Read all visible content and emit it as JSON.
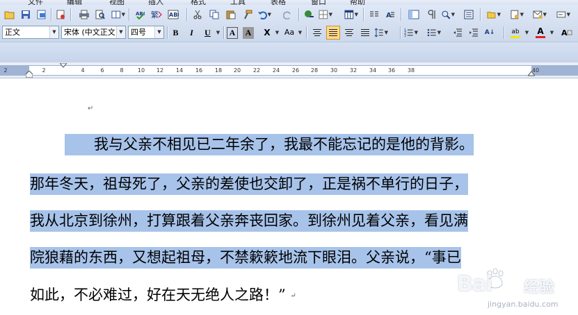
{
  "menu": {
    "items": [
      "文件",
      "编辑",
      "视图",
      "插入",
      "格式",
      "工具",
      "表格",
      "窗口",
      "帮助"
    ]
  },
  "toolbar": {
    "style_value": "正文",
    "font_value": "宋体 (中文正文",
    "size_value": "四号",
    "bold_label": "B",
    "italic_label": "I",
    "underline_label": "U",
    "border_label": "A",
    "shading_label": "A",
    "scale_label": "X",
    "case_label": "Aa",
    "highlight_label": "ab",
    "font_color_label": "A",
    "sort_label": "A↓",
    "accent_highlight": "#ffd98a",
    "font_color_swatch": "#e02020",
    "highlight_swatch": "#f3e600"
  },
  "ruler": {
    "labels": [
      "2",
      "2",
      "4",
      "6",
      "8",
      "10",
      "12",
      "14",
      "16",
      "18",
      "20",
      "22",
      "24",
      "26",
      "28",
      "30",
      "32",
      "34",
      "36",
      "38",
      "40"
    ]
  },
  "document": {
    "paragraph_mark": "↵",
    "lines": [
      "　　我与父亲不相见已二年余了，我最不能忘记的是他的背影。",
      "那年冬天，祖母死了，父亲的差使也交卸了，正是祸不单行的日子，",
      "我从北京到徐州，打算跟着父亲奔丧回家。到徐州见着父亲，看见满",
      "院狼藉的东西，又想起祖母，不禁簌簌地流下眼泪。父亲说，“事已",
      "如此，不必难过，好在天无绝人之路！”"
    ],
    "selection_color": "#a7c3ea"
  },
  "watermark": {
    "brand": "Bai",
    "brand_cn": "经验",
    "site": "jingyan.baidu.com"
  }
}
